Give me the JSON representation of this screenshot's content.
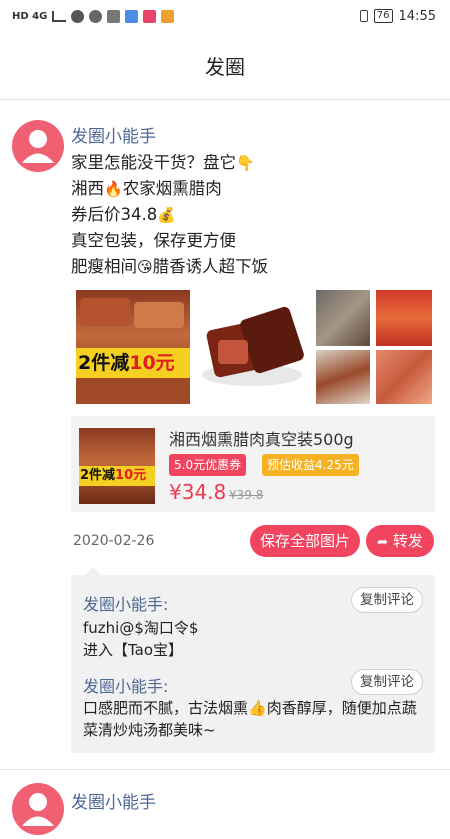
{
  "status_bar": {
    "network": "HD 4G",
    "battery": "76",
    "time": "14:55"
  },
  "header": {
    "title": "发圈"
  },
  "post": {
    "author": "发圈小能手",
    "lines": [
      {
        "text": "家里怎能没干货？盘它",
        "emoji": "👇"
      },
      {
        "text": "湘西",
        "emoji": "🔥",
        "text2": "农家烟熏腊肉"
      },
      {
        "text": "券后价34.8",
        "emoji": "💰"
      },
      {
        "text": "真空包装，保存更方便"
      },
      {
        "text": "肥瘦相间",
        "emoji": "😘",
        "text2": "腊香诱人超下饭"
      }
    ],
    "image_overlay": {
      "prefix": "2件减",
      "amount": "10元"
    },
    "product": {
      "name": "湘西烟熏腊肉真空装500g",
      "coupon_tag": "5.0元优惠券",
      "earn_tag": "预估收益4.25元",
      "price": "¥34.8",
      "old_price": "¥39.8",
      "thumb_overlay": {
        "prefix": "2件减",
        "amount": "10元"
      }
    },
    "date": "2020-02-26",
    "save_all_label": "保存全部图片",
    "share_label": "转发",
    "comments": [
      {
        "author": "发圈小能手:",
        "text": "fuzhi@$淘口令$",
        "text2": "进入【Tao宝】",
        "copy_label": "复制评论"
      },
      {
        "author": "发圈小能手:",
        "text": "口感肥而不腻，古法烟熏",
        "emoji": "👍",
        "text2": "肉香醇厚，随便加点蔬菜清炒炖汤都美味~",
        "copy_label": "复制评论"
      }
    ]
  },
  "next_post": {
    "author": "发圈小能手"
  },
  "colors": {
    "accent": "#f0445f",
    "author": "#4e6896",
    "price": "#ef3a4f",
    "earn": "#f7b224"
  }
}
